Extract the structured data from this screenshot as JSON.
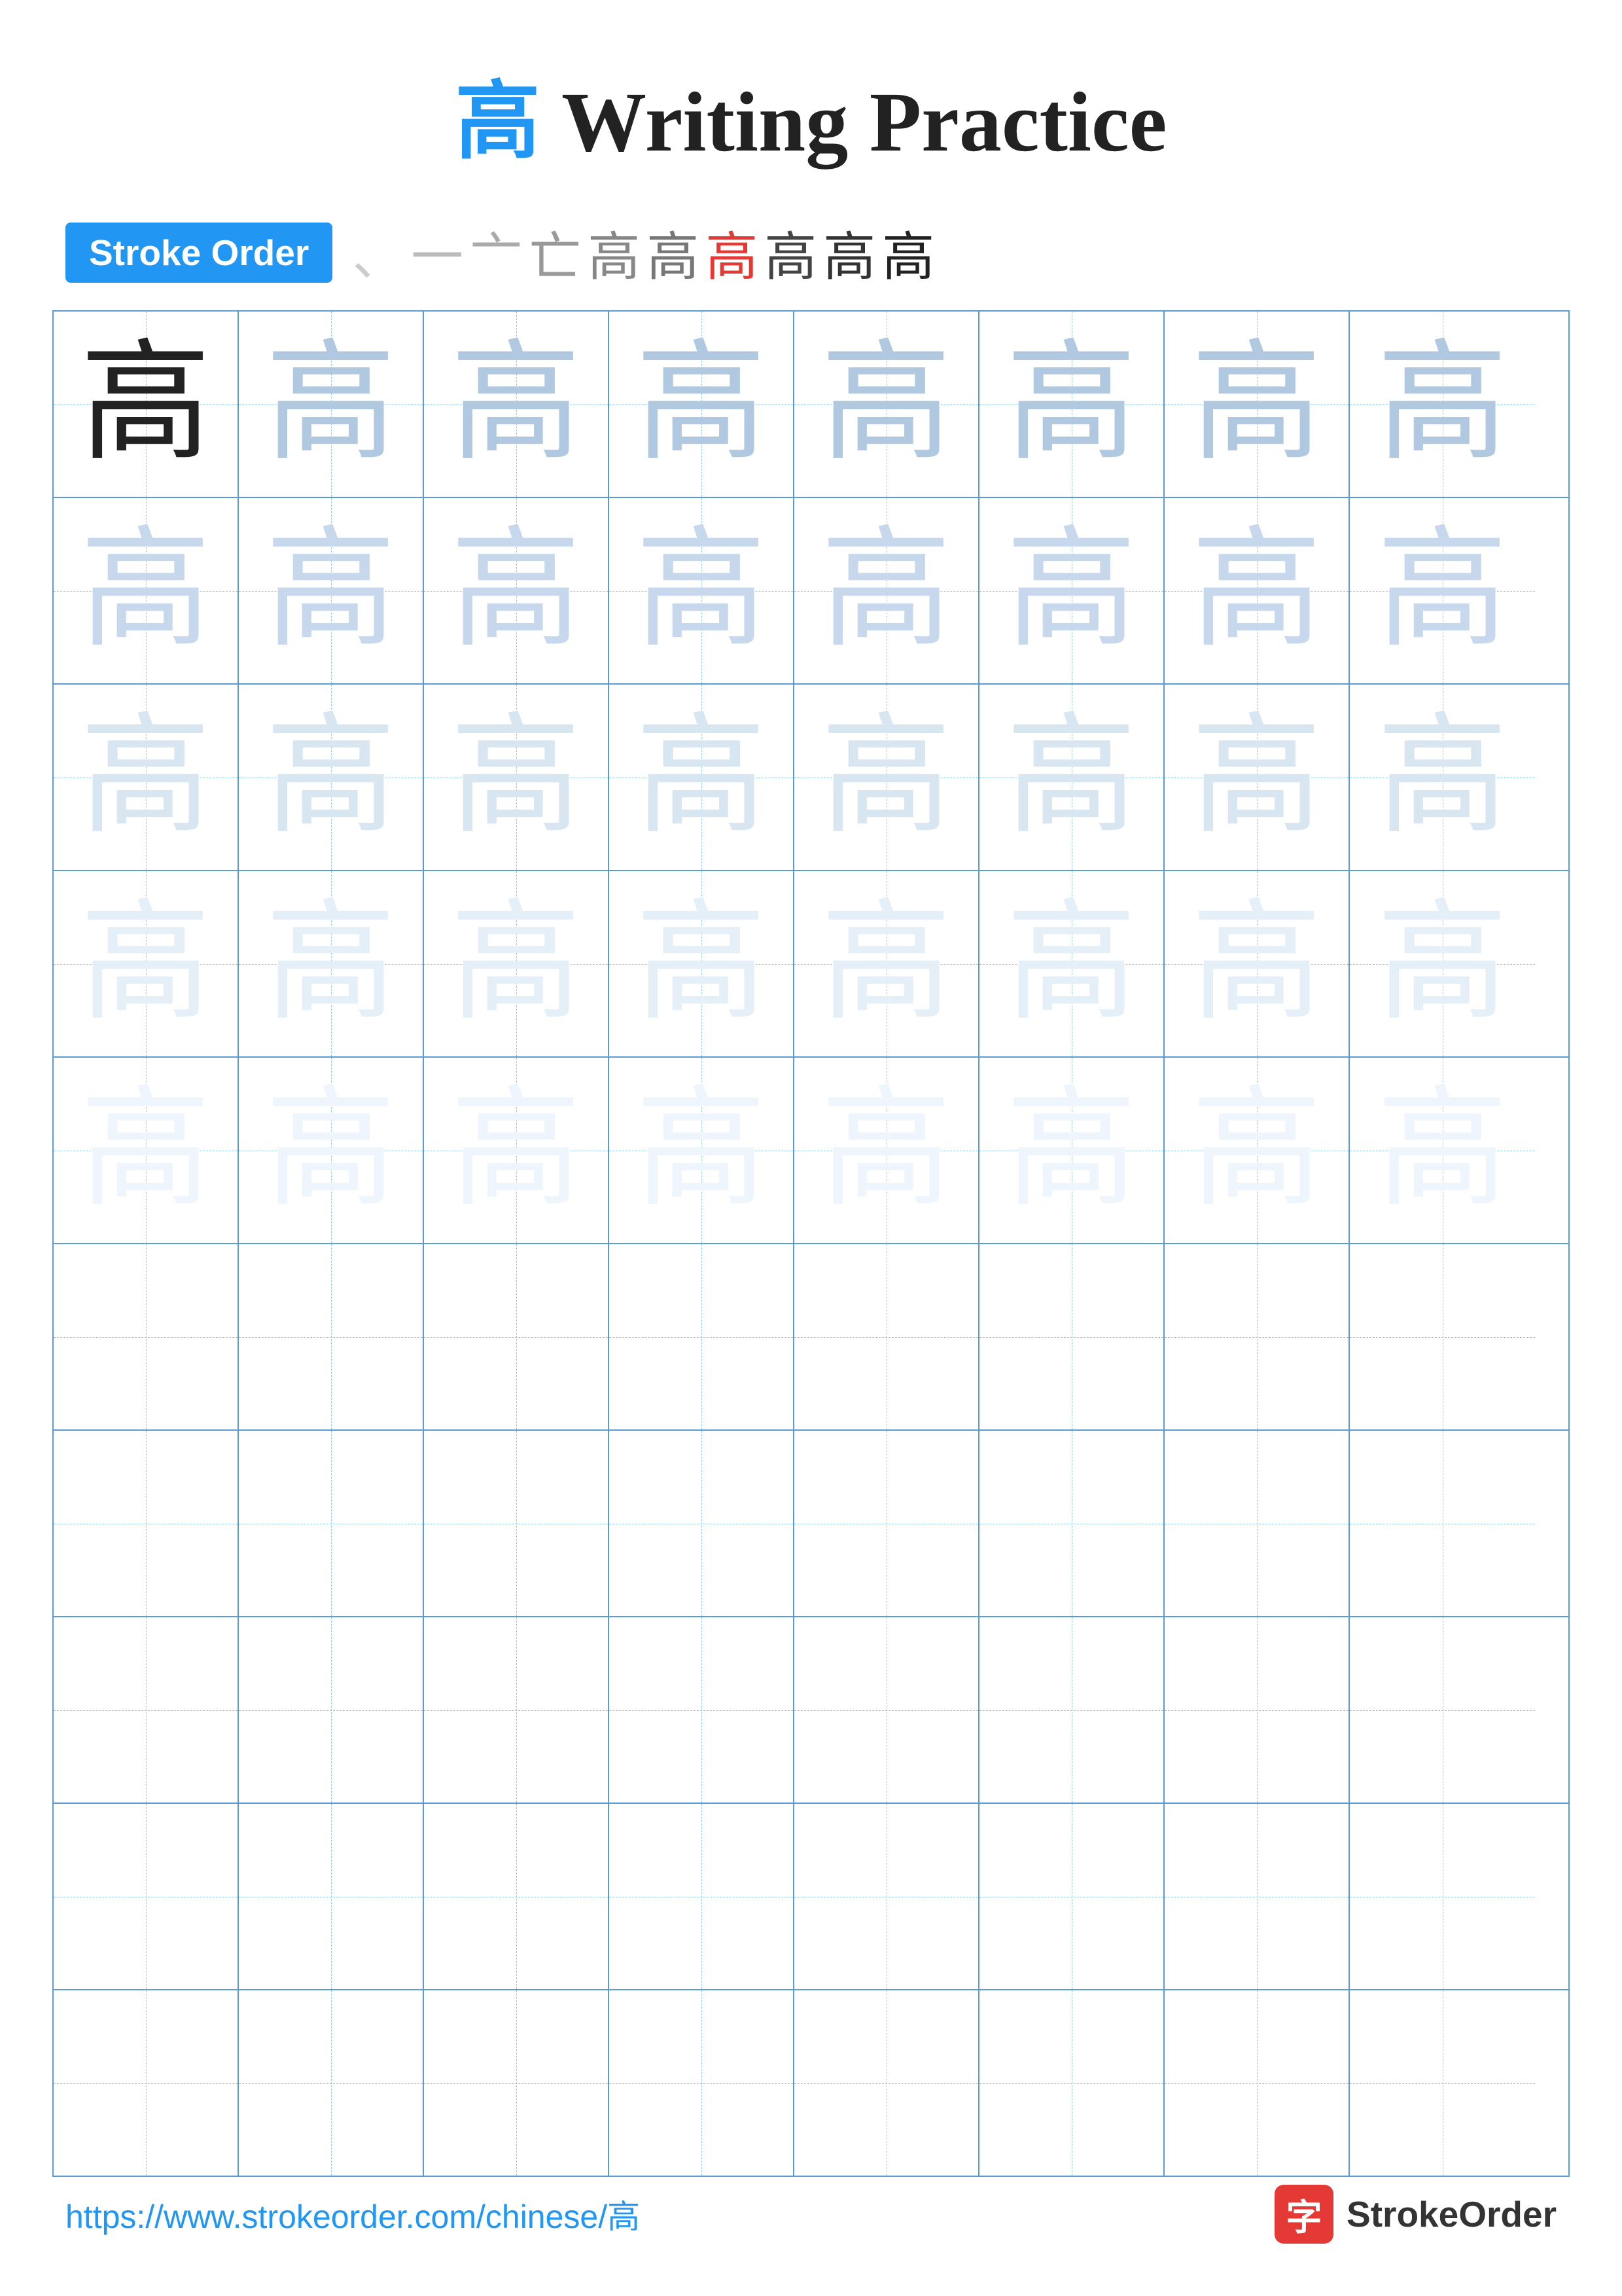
{
  "title": {
    "char": "高",
    "rest": " Writing Practice"
  },
  "stroke_order": {
    "badge_label": "Stroke Order",
    "strokes": [
      {
        "text": "、",
        "style": "light"
      },
      {
        "text": "一",
        "style": "light"
      },
      {
        "text": "亠",
        "style": "light"
      },
      {
        "text": "亡",
        "style": "light"
      },
      {
        "text": "亡",
        "style": "light"
      },
      {
        "text": "亨",
        "style": "light"
      },
      {
        "text": "高",
        "style": "highlight"
      },
      {
        "text": "高",
        "style": "dark"
      },
      {
        "text": "高",
        "style": "dark"
      },
      {
        "text": "高",
        "style": "dark"
      }
    ]
  },
  "grid": {
    "rows": 10,
    "cols": 8
  },
  "character": "高",
  "footer": {
    "url": "https://www.strokeorder.com/chinese/高",
    "brand": "StrokeOrder"
  }
}
